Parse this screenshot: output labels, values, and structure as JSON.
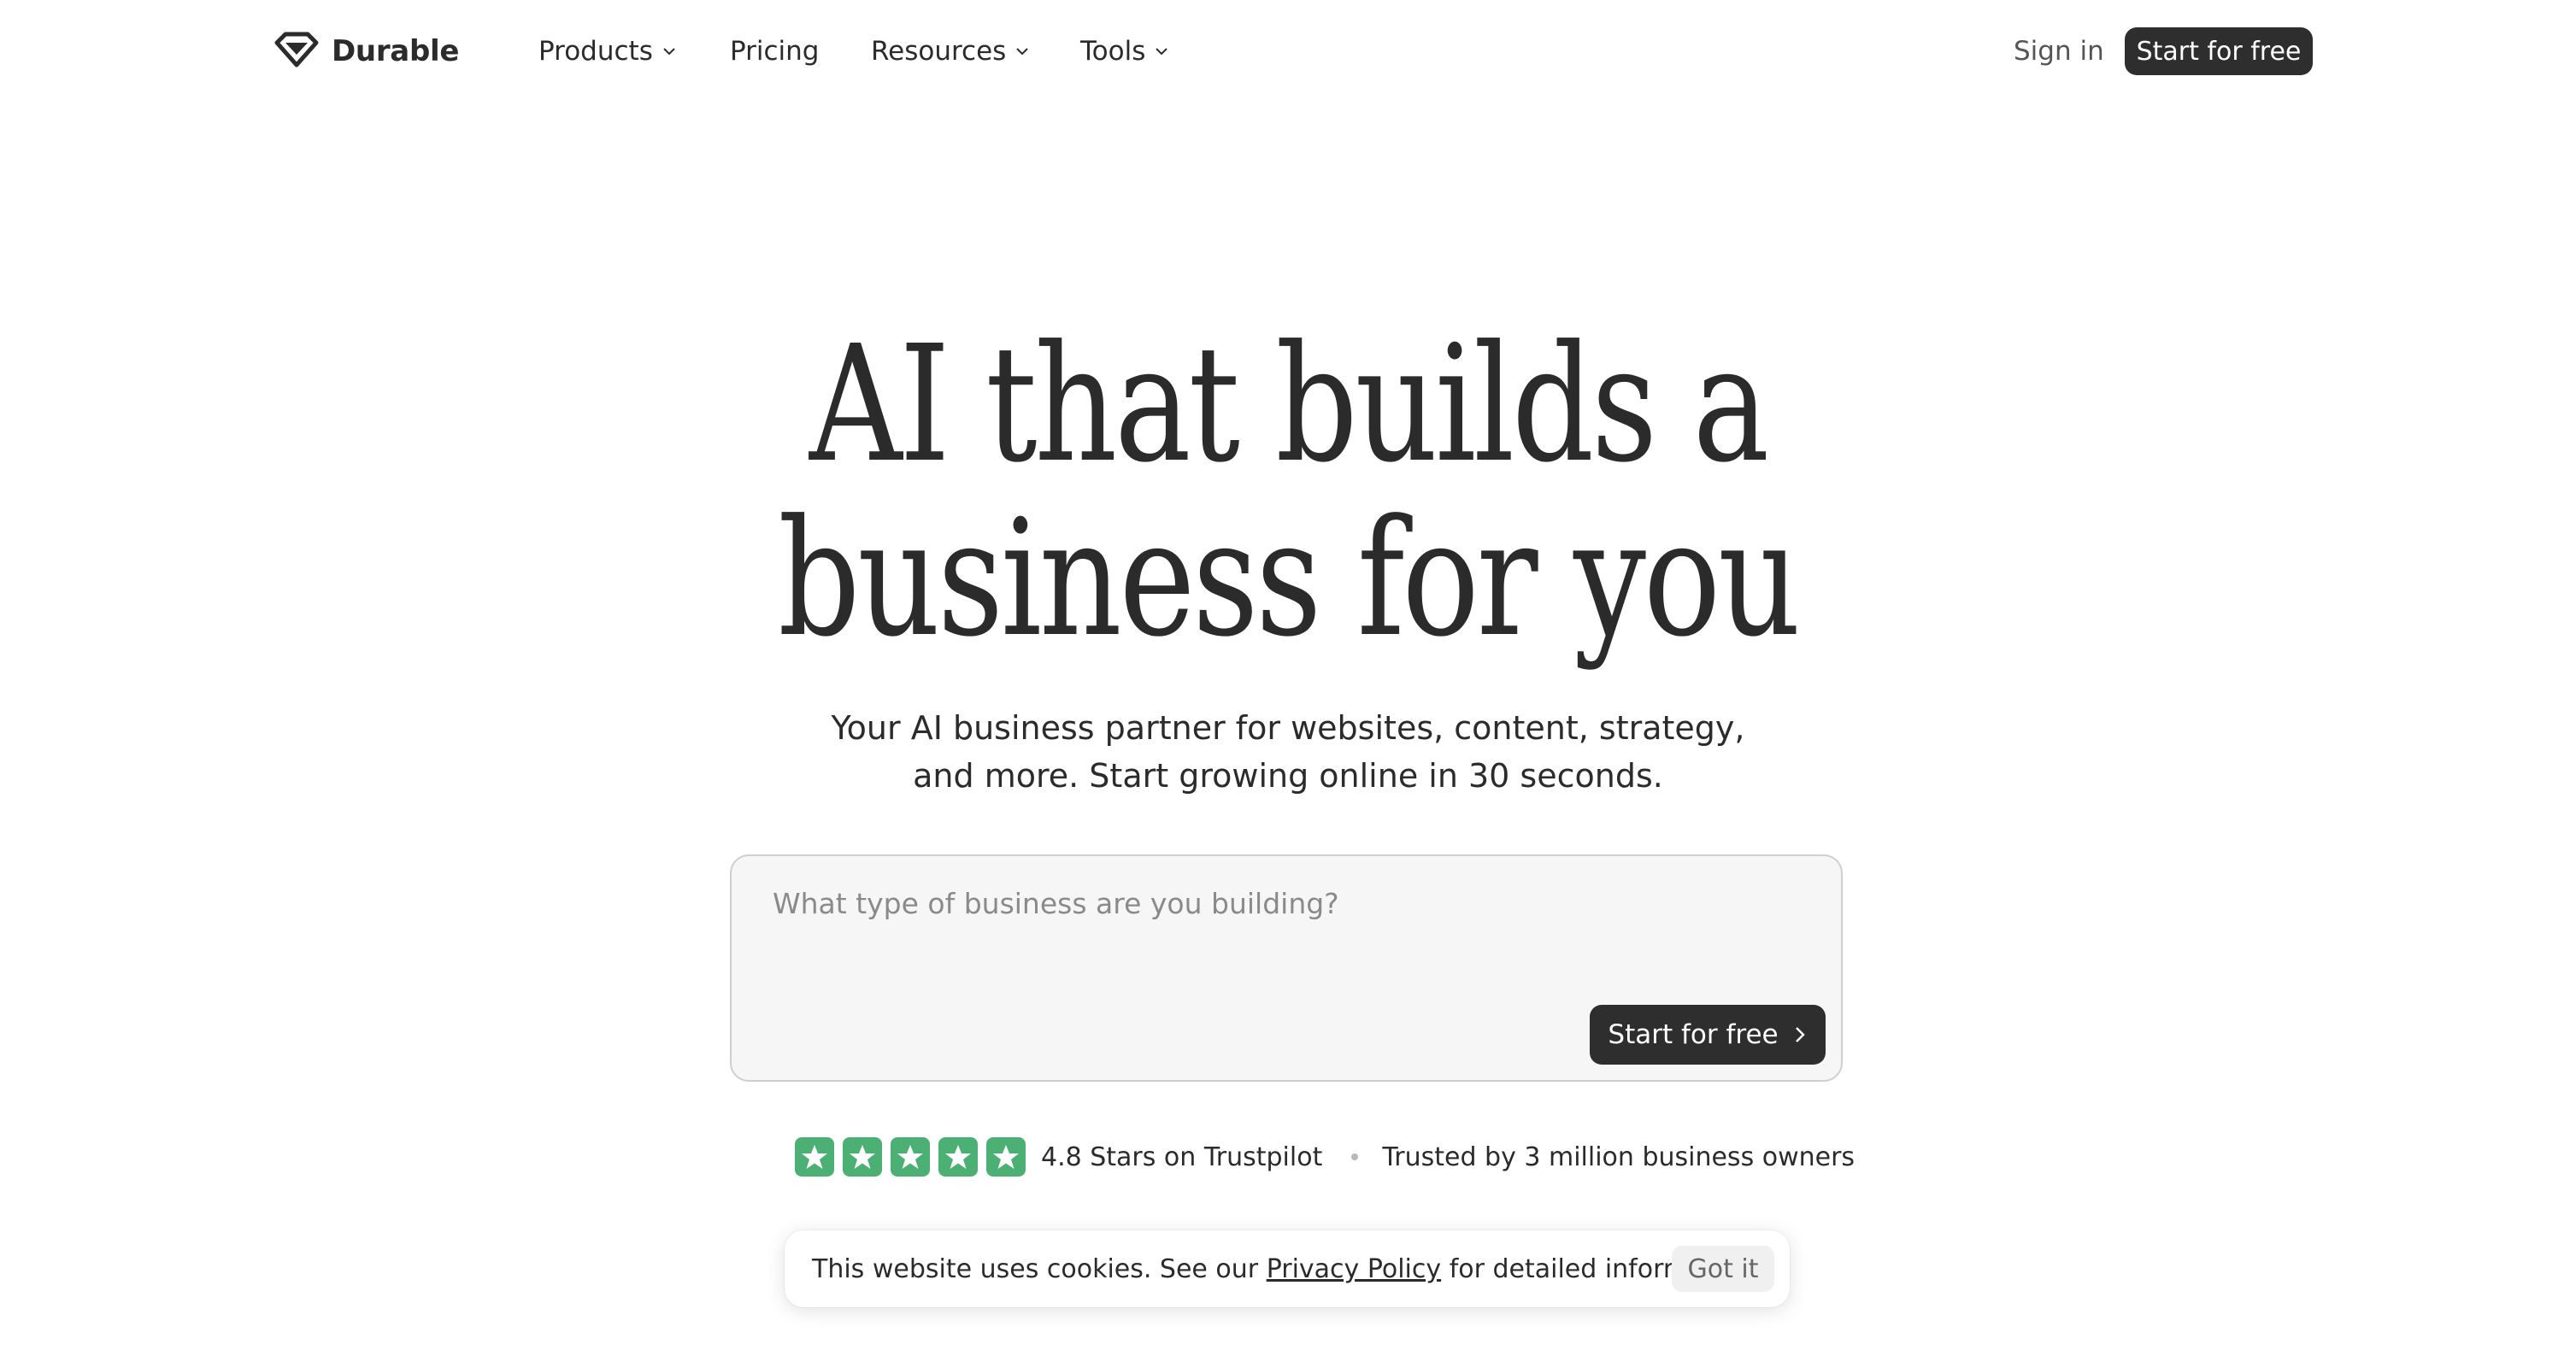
{
  "nav": {
    "brand": "Durable",
    "items": [
      {
        "label": "Products",
        "has_dropdown": true
      },
      {
        "label": "Pricing",
        "has_dropdown": false
      },
      {
        "label": "Resources",
        "has_dropdown": true
      },
      {
        "label": "Tools",
        "has_dropdown": true
      }
    ],
    "sign_in": "Sign in",
    "cta": "Start for free"
  },
  "hero": {
    "title_line1": "AI that builds a",
    "title_line2": "business for you",
    "subtitle_line1": "Your AI business partner for websites, content, strategy,",
    "subtitle_line2": "and more. Start growing online in 30 seconds."
  },
  "prompt": {
    "placeholder": "What type of business are you building?",
    "value": "",
    "button": "Start for free"
  },
  "trust": {
    "star_count": 5,
    "rating_text": "4.8 Stars on Trustpilot",
    "trusted_text": "Trusted by 3 million business owners",
    "star_color": "#4caf73"
  },
  "cookie": {
    "text_before": "This website uses cookies. See our",
    "link": "Privacy Policy",
    "text_after": "for detailed information.",
    "button": "Got it"
  },
  "colors": {
    "primary_button": "#2e2e2e",
    "text": "#2b2b2b",
    "background": "#ffffff"
  }
}
